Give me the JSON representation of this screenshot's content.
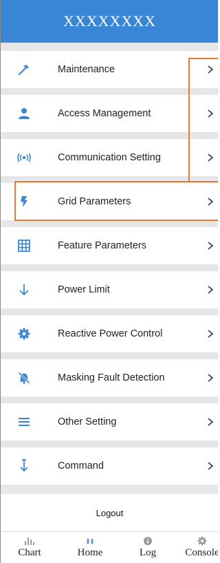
{
  "header": {
    "title": "XXXXXXXX"
  },
  "menu": {
    "items": [
      {
        "label": "Maintenance",
        "icon": "hammer-icon"
      },
      {
        "label": "Access Management",
        "icon": "user-icon"
      },
      {
        "label": "Communication Setting",
        "icon": "signal-icon"
      },
      {
        "label": "Grid Parameters",
        "icon": "bolt-icon"
      },
      {
        "label": "Feature Parameters",
        "icon": "grid-icon"
      },
      {
        "label": "Power Limit",
        "icon": "arrow-down-icon"
      },
      {
        "label": "Reactive Power Control",
        "icon": "gear-icon"
      },
      {
        "label": "Masking Fault Detection",
        "icon": "bell-off-icon"
      },
      {
        "label": "Other Setting",
        "icon": "menu-icon"
      },
      {
        "label": "Command",
        "icon": "command-arrow-icon"
      }
    ],
    "logout": "Logout"
  },
  "bottom_nav": {
    "items": [
      {
        "label": "Chart",
        "icon": "bar-chart-icon"
      },
      {
        "label": "Home",
        "icon": "home-icon"
      },
      {
        "label": "Log",
        "icon": "info-icon"
      },
      {
        "label": "Console",
        "icon": "settings-icon"
      }
    ]
  },
  "colors": {
    "accent": "#3a86d6",
    "highlight": "#e87a30",
    "gap": "#e6e6e6"
  }
}
